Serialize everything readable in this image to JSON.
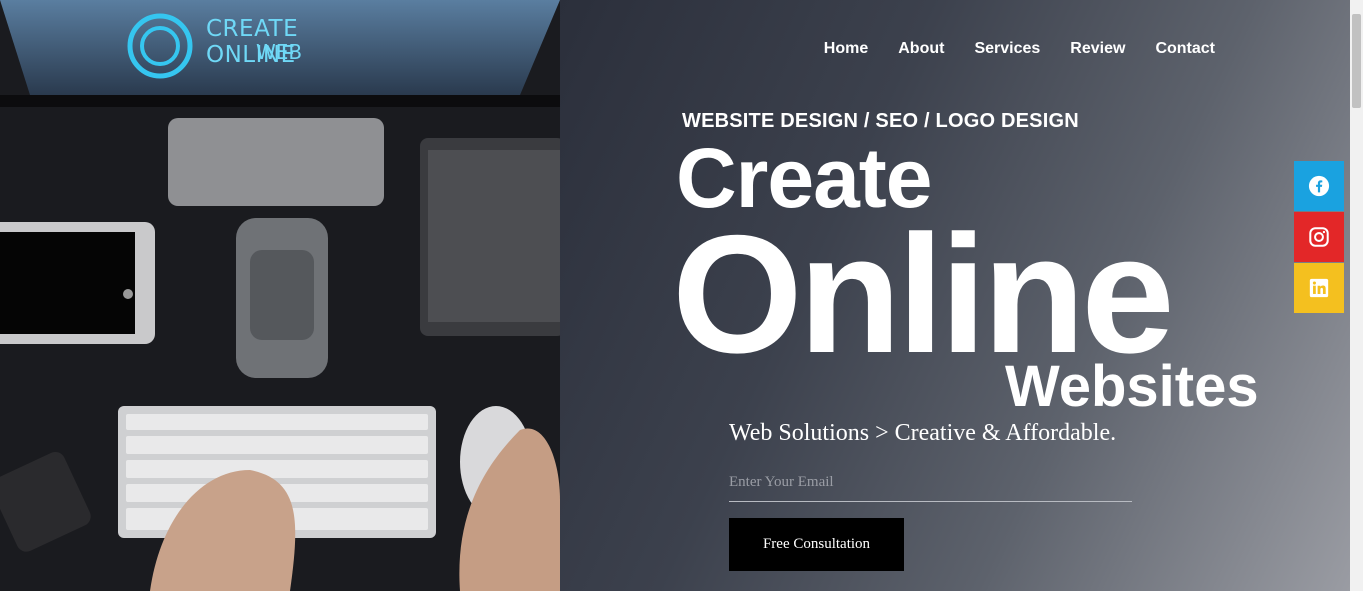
{
  "hero_image": {
    "logo_line1": "CREATE ONLINE",
    "logo_line2": "WEB"
  },
  "nav": {
    "items": [
      {
        "label": "Home"
      },
      {
        "label": "About"
      },
      {
        "label": "Services"
      },
      {
        "label": "Review"
      },
      {
        "label": "Contact"
      }
    ]
  },
  "hero": {
    "tagline": "WEBSITE DESIGN / SEO / LOGO DESIGN",
    "heading_line1": "Create",
    "heading_line2": "Online",
    "heading_line3": "Websites",
    "subheading": "Web Solutions > Creative & Affordable.",
    "email_placeholder": "Enter Your Email",
    "cta_label": "Free Consultation"
  },
  "social": [
    {
      "icon": "facebook-icon",
      "color": "#1aa2e0"
    },
    {
      "icon": "instagram-icon",
      "color": "#e32728"
    },
    {
      "icon": "linkedin-icon",
      "color": "#f4c01f"
    }
  ]
}
